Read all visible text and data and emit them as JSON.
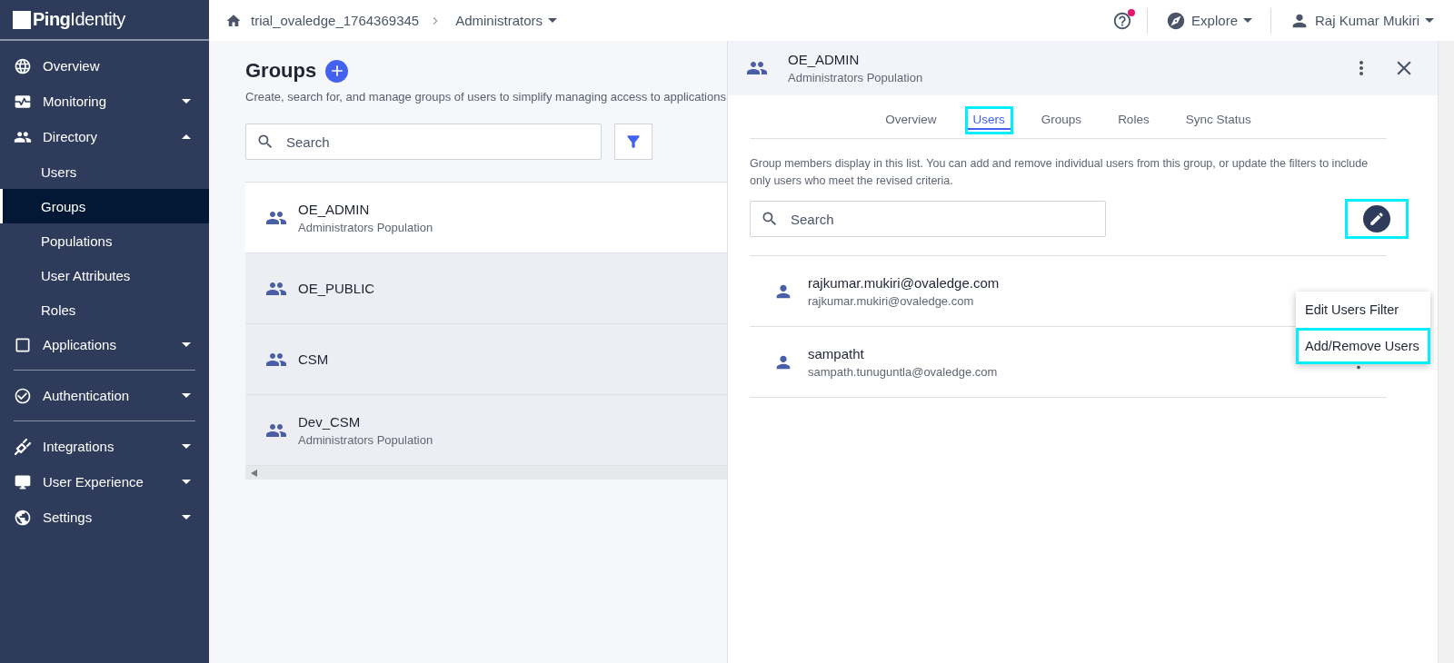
{
  "sidebar": {
    "logo": {
      "strong": "Ping",
      "light": "Identity"
    },
    "sections": [
      [
        {
          "label": "Overview"
        },
        {
          "label": "Monitoring",
          "expanded": false
        },
        {
          "label": "Directory",
          "expanded": true,
          "children": [
            {
              "label": "Users",
              "selected": false
            },
            {
              "label": "Groups",
              "selected": true
            },
            {
              "label": "Populations",
              "selected": false
            },
            {
              "label": "User Attributes",
              "selected": false
            },
            {
              "label": "Roles",
              "selected": false
            }
          ]
        },
        {
          "label": "Applications",
          "expanded": false
        }
      ],
      [
        {
          "label": "Authentication",
          "expanded": false
        }
      ],
      [
        {
          "label": "Integrations",
          "expanded": false
        },
        {
          "label": "User Experience",
          "expanded": false
        },
        {
          "label": "Settings",
          "expanded": false
        }
      ]
    ]
  },
  "top_bar": {
    "breadcrumb": [
      "trial_ovaledge_1764369345",
      "Administrators"
    ],
    "help_notification": true,
    "explore": "Explore",
    "user": "Raj Kumar Mukiri"
  },
  "page": {
    "title": "Groups",
    "description": "Create, search for, and manage groups of users to simplify managing access to applications",
    "search": {
      "placeholder": "Search"
    },
    "groups": [
      {
        "name": "OE_ADMIN",
        "population": "Administrators Population",
        "selected": true
      },
      {
        "name": "OE_PUBLIC",
        "selected": false
      },
      {
        "name": "CSM",
        "selected": false
      },
      {
        "name": "Dev_CSM",
        "population": "Administrators Population",
        "selected": false
      }
    ]
  },
  "panel": {
    "title": "OE_ADMIN",
    "subtitle": "Administrators Population",
    "tabs": [
      {
        "label": "Overview",
        "selected": false,
        "highlighted": false
      },
      {
        "label": "Users",
        "selected": true,
        "highlighted": true
      },
      {
        "label": "Groups",
        "selected": false,
        "highlighted": false
      },
      {
        "label": "Roles",
        "selected": false,
        "highlighted": false
      },
      {
        "label": "Sync Status",
        "selected": false,
        "highlighted": false
      }
    ],
    "description": "Group members display in this list. You can add and remove individual users from this group, or update the filters to include only users who meet the revised criteria.",
    "search": {
      "placeholder": "Search"
    },
    "edit_highlighted": true,
    "members": [
      {
        "name": "rajkumar.mukiri@ovaledge.com",
        "email": "rajkumar.mukiri@ovaledge.com"
      },
      {
        "name": "sampatht",
        "email": "sampath.tunuguntla@ovaledge.com"
      }
    ],
    "menu": [
      {
        "label": "Edit Users Filter",
        "highlighted": false
      },
      {
        "label": "Add/Remove Users",
        "highlighted": true
      }
    ]
  }
}
